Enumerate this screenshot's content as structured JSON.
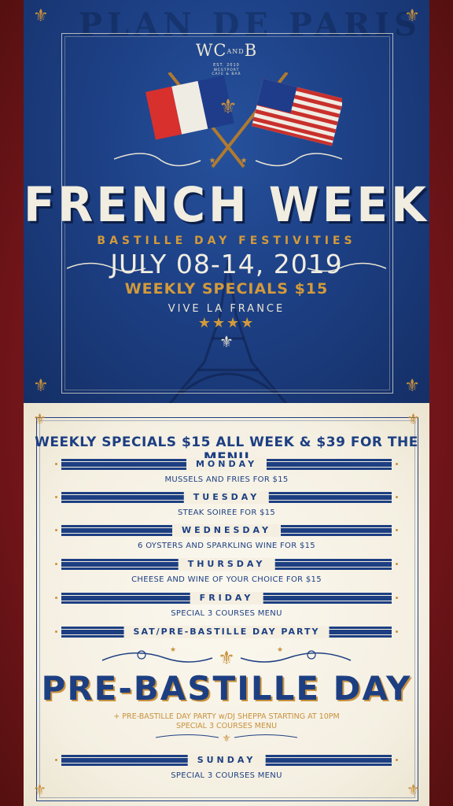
{
  "poster": {
    "watermark": "PLAN DE PARIS",
    "logo": {
      "mark_left": "WC",
      "mark_and": "AND",
      "mark_right": "B",
      "est": "EST. 2010",
      "sub_line1": "WESTPORT",
      "sub_line2": "CAFE & BAR"
    },
    "title": "FRENCH WEEK",
    "subtitle": "BASTILLE DAY FESTIVITIES",
    "dates": "JULY 08-14, 2019",
    "specials": "WEEKLY SPECIALS $15",
    "tagline": "VIVE LA FRANCE",
    "stars": "★★★★"
  },
  "menu": {
    "headline": "WEEKLY SPECIALS $15 ALL WEEK & $39 FOR THE MENU",
    "days": [
      {
        "label": "MONDAY",
        "item": "MUSSELS AND FRIES FOR $15"
      },
      {
        "label": "TUESDAY",
        "item": "STEAK SOIREE FOR $15"
      },
      {
        "label": "WEDNESDAY",
        "item": "6 OYSTERS AND SPARKLING WINE FOR $15"
      },
      {
        "label": "THURSDAY",
        "item": "CHEESE AND WINE OF YOUR CHOICE FOR $15"
      },
      {
        "label": "FRIDAY",
        "item": "SPECIAL 3 COURSES MENU"
      },
      {
        "label": "SAT/PRE-BASTILLE DAY PARTY"
      }
    ],
    "pre_bastille": {
      "title": "PRE-BASTILLE DAY",
      "line1": "+ PRE-BASTILLE DAY PARTY w/DJ SHEPPA STARTING AT 10PM",
      "line2": "SPECIAL 3 COURSES MENU"
    },
    "sunday": {
      "label": "SUNDAY",
      "item": "SPECIAL 3 COURSES MENU"
    }
  },
  "colors": {
    "navy": "#1d3f82",
    "gold": "#c8913d",
    "cream": "#f4efe1",
    "red": "#7a1a1f",
    "poster_blue": "#1d4085"
  },
  "icons": {
    "corner": "fleur-de-lis-icon",
    "flags": "crossed-flags-icon",
    "tower": "eiffel-tower-icon"
  }
}
